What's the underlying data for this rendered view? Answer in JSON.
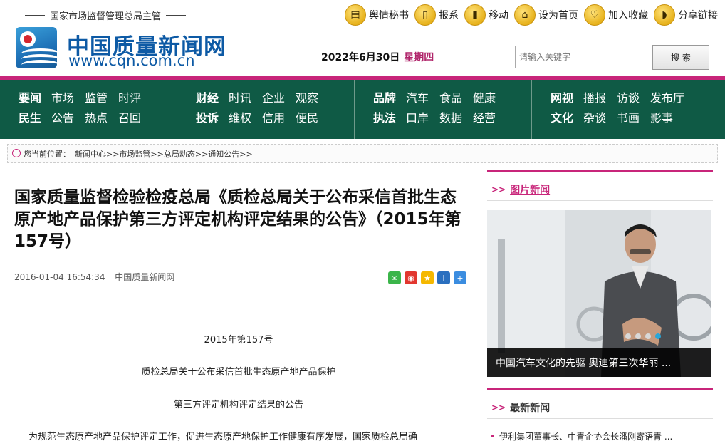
{
  "header": {
    "supervisor": "国家市场监督管理总局主管",
    "site_name": "中国质量新闻网",
    "site_url": "www.cqn.com.cn",
    "quick_links": [
      {
        "label": "舆情秘书",
        "icon": "book-icon"
      },
      {
        "label": "报系",
        "icon": "document-icon"
      },
      {
        "label": "移动",
        "icon": "phone-icon"
      },
      {
        "label": "设为首页",
        "icon": "home-icon"
      },
      {
        "label": "加入收藏",
        "icon": "heart-icon"
      },
      {
        "label": "分享链接",
        "icon": "rss-icon"
      }
    ],
    "date": "2022年6月30日",
    "weekday": "星期四",
    "search_placeholder": "请输入关键字",
    "search_button": "搜 索"
  },
  "nav": [
    {
      "rows": [
        {
          "head": "要闻",
          "items": [
            "市场",
            "监管",
            "时评"
          ]
        },
        {
          "head": "民生",
          "items": [
            "公告",
            "热点",
            "召回"
          ]
        }
      ]
    },
    {
      "rows": [
        {
          "head": "财经",
          "items": [
            "时讯",
            "企业",
            "观察"
          ]
        },
        {
          "head": "投诉",
          "items": [
            "维权",
            "信用",
            "便民"
          ]
        }
      ]
    },
    {
      "rows": [
        {
          "head": "品牌",
          "items": [
            "汽车",
            "食品",
            "健康"
          ]
        },
        {
          "head": "执法",
          "items": [
            "口岸",
            "数据",
            "经营"
          ]
        }
      ]
    },
    {
      "rows": [
        {
          "head": "网视",
          "items": [
            "播报",
            "访谈",
            "发布厅"
          ]
        },
        {
          "head": "文化",
          "items": [
            "杂谈",
            "书画",
            "影事"
          ]
        }
      ]
    }
  ],
  "breadcrumb": {
    "label": "您当前位置：",
    "path": "新闻中心>>市场监管>>总局动态>>通知公告>>"
  },
  "article": {
    "title": "国家质量监督检验检疫总局《质检总局关于公布采信首批生态原产地产品保护第三方评定机构评定结果的公告》（2015年第157号）",
    "datetime": "2016-01-04 16:54:34",
    "source": "中国质量新闻网",
    "paragraphs": [
      "2015年第157号",
      "质检总局关于公布采信首批生态原产地产品保护",
      "第三方评定机构评定结果的公告",
      "为规范生态原产地产品保护评定工作，促进生态原产地保护工作健康有序发展，国家质检总局确"
    ]
  },
  "share_icons": [
    "wechat-icon",
    "weibo-icon",
    "qzone-icon",
    "renren-icon",
    "more-icon"
  ],
  "sidebar": {
    "photo_news_title": "图片新闻",
    "photo_caption": "中国汽车文化的先驱 奥迪第三次华丽 ...",
    "slide_count": 4,
    "active_slide": 4,
    "latest_news_title": "最新新闻",
    "latest_items": [
      "伊利集团董事长、中青企协会长潘刚寄语青 ..."
    ]
  },
  "colors": {
    "accent": "#c8257a",
    "nav_bg": "#0f5a45",
    "brand_blue": "#0d5aa5"
  }
}
